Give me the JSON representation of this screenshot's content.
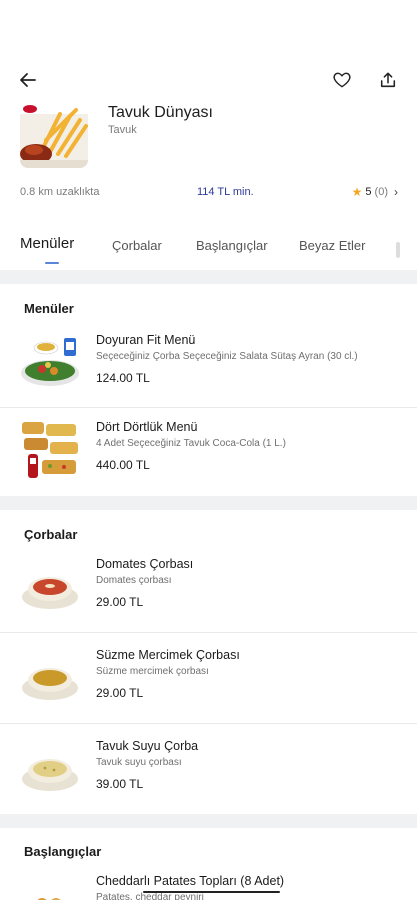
{
  "restaurant": {
    "name": "Tavuk Dünyası",
    "category": "Tavuk",
    "distance": "0.8 km uzaklıkta",
    "min_order": "114 TL min.",
    "rating": "5",
    "rating_count": "(0)"
  },
  "tabs": [
    {
      "label": "Menüler",
      "active": true
    },
    {
      "label": "Çorbalar",
      "active": false
    },
    {
      "label": "Başlangıçlar",
      "active": false
    },
    {
      "label": "Beyaz Etler",
      "active": false
    }
  ],
  "sections": [
    {
      "title": "Menüler",
      "items": [
        {
          "name": "Doyuran Fit Menü",
          "desc": "Seçeceğiniz Çorba   Seçeceğiniz Salata   Sütaş Ayran (30 cl.)",
          "price": "124.00 TL"
        },
        {
          "name": "Dört Dörtlük Menü",
          "desc": "4 Adet Seçeceğiniz Tavuk   Coca-Cola (1 L.)",
          "price": "440.00 TL"
        }
      ]
    },
    {
      "title": "Çorbalar",
      "items": [
        {
          "name": "Domates Çorbası",
          "desc": "Domates çorbası",
          "price": "29.00 TL"
        },
        {
          "name": "Süzme Mercimek Çorbası",
          "desc": "Süzme mercimek çorbası",
          "price": "29.00 TL"
        },
        {
          "name": "Tavuk Suyu Çorba",
          "desc": "Tavuk suyu çorbası",
          "price": "39.00 TL"
        }
      ]
    },
    {
      "title": "Başlangıçlar",
      "items": [
        {
          "name": "Cheddarlı Patates Topları (8 Adet)",
          "desc": "Patates, cheddar peyniri",
          "price": ""
        }
      ]
    }
  ],
  "icons": {
    "back": "arrow-left-icon",
    "favorite": "heart-icon",
    "share": "share-icon",
    "rating": "star-icon",
    "rating_more": "chevron-right-icon"
  },
  "colors": {
    "accent_blue": "#2f3a96",
    "star": "#f5a623",
    "tab_indicator": "#5a86d6",
    "divider": "#f0f1f3"
  }
}
